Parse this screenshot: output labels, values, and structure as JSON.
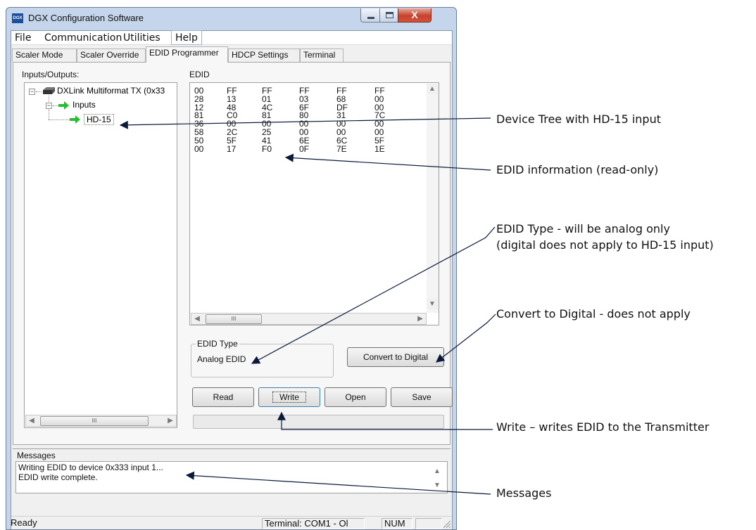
{
  "window": {
    "title": "DGX Configuration Software",
    "icon_text": "DGX",
    "close_glyph": "X"
  },
  "menu": [
    "File",
    "Communication",
    "Utilities",
    "Help"
  ],
  "tabs": [
    "Scaler Mode",
    "Scaler Override",
    "EDID Programmer",
    "HDCP Settings",
    "Terminal"
  ],
  "selected_tab": "EDID Programmer",
  "left_panel": {
    "label": "Inputs/Outputs:",
    "tree": {
      "root": "DXLink Multiformat TX (0x33",
      "group": "Inputs",
      "selected": "HD-15"
    }
  },
  "edid": {
    "label": "EDID",
    "columns": [
      [
        "00",
        "28",
        "12",
        "81",
        "36",
        "58",
        "50",
        "00"
      ],
      [
        "FF",
        "13",
        "48",
        "C0",
        "00",
        "2C",
        "5F",
        "17"
      ],
      [
        "FF",
        "01",
        "4C",
        "81",
        "00",
        "25",
        "41",
        "F0"
      ],
      [
        "FF",
        "03",
        "6F",
        "80",
        "00",
        "00",
        "6E",
        "0F"
      ],
      [
        "FF",
        "68",
        "DF",
        "31",
        "00",
        "00",
        "6C",
        "7E"
      ],
      [
        "FF",
        "00",
        "00",
        "7C",
        "00",
        "00",
        "5F",
        "1E"
      ]
    ]
  },
  "edid_type": {
    "legend": "EDID Type",
    "value": "Analog EDID"
  },
  "buttons": {
    "convert": "Convert to Digital",
    "read": "Read",
    "write": "Write",
    "open": "Open",
    "save": "Save"
  },
  "scroll_thumb_glyph": "III",
  "messages": {
    "label": "Messages",
    "lines": [
      "Writing EDID to device 0x333 input 1...",
      "EDID write complete."
    ]
  },
  "status": {
    "ready": "Ready",
    "terminal": "Terminal: COM1 - Ol",
    "num": "NUM"
  },
  "callouts": {
    "device_tree": "Device Tree with HD-15 input",
    "edid_info": "EDID information (read-only)",
    "edid_type_1": "EDID Type - will be analog only",
    "edid_type_2": "(digital does not apply to HD-15 input)",
    "convert": "Convert to Digital - does not apply",
    "write": "Write – writes EDID to the Transmitter",
    "messages": "Messages"
  }
}
